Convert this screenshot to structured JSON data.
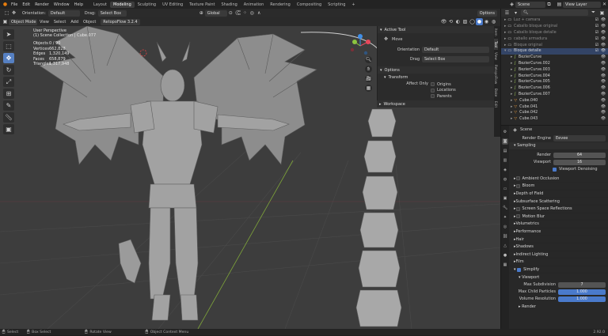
{
  "menubar": {
    "menus": [
      "File",
      "Edit",
      "Render",
      "Window",
      "Help"
    ],
    "workspaces": [
      "Layout",
      "Modeling",
      "Sculpting",
      "UV Editing",
      "Texture Paint",
      "Shading",
      "Animation",
      "Rendering",
      "Compositing",
      "Scripting"
    ],
    "active_workspace": "Modeling",
    "add_tab": "+",
    "scene": "Scene",
    "view_layer": "View Layer"
  },
  "tool_header": {
    "orientation_label": "Orientation:",
    "orientation_value": "Default",
    "drag_label": "Drag:",
    "drag_value": "Select Box",
    "transform_value": "Global",
    "options_label": "Options"
  },
  "viewport_header": {
    "mode": "Object Mode",
    "menus": [
      "View",
      "Select",
      "Add",
      "Object"
    ],
    "addon": "RetopoFlow 3.2.4"
  },
  "viewport": {
    "title": "User Perspective",
    "collection": "(1) Scene Collection | Cube.077",
    "stats": [
      {
        "label": "Objects",
        "value": "0 / 90"
      },
      {
        "label": "Vertices",
        "value": "662,828"
      },
      {
        "label": "Edges",
        "value": "1,320,149"
      },
      {
        "label": "Faces",
        "value": "658,879"
      },
      {
        "label": "Triangles",
        "value": "1,317,948"
      }
    ]
  },
  "n_panel": {
    "tabs": [
      "Item",
      "Tool",
      "View",
      "RetopoFlow",
      "Bake",
      "Edit"
    ],
    "active_tool_title": "Active Tool",
    "tool_name": "Move",
    "orientation_label": "Orientation",
    "orientation_value": "Default",
    "drag_label": "Drag",
    "drag_value": "Select Box",
    "options_title": "Options",
    "transform_title": "Transform",
    "affect_only_label": "Affect Only",
    "affect_items": [
      "Origins",
      "Locations",
      "Parents"
    ],
    "workspace_title": "Workspace"
  },
  "outliner": {
    "rows": [
      {
        "name": "Luz + camara",
        "indent": 0,
        "expanded": false,
        "icon": "collection",
        "color": "#8a8a8a"
      },
      {
        "name": "Caballo bloque original",
        "indent": 0,
        "expanded": false,
        "icon": "collection",
        "color": "#8a8a8a"
      },
      {
        "name": "Caballo bloque detalle",
        "indent": 0,
        "expanded": false,
        "icon": "collection",
        "color": "#8a8a8a"
      },
      {
        "name": "caballo armadura",
        "indent": 0,
        "expanded": false,
        "icon": "collection",
        "color": "#8a8a8a"
      },
      {
        "name": "Bloque original",
        "indent": 0,
        "expanded": false,
        "icon": "collection",
        "color": "#8a8a8a"
      },
      {
        "name": "Bloque detalle",
        "indent": 0,
        "expanded": true,
        "icon": "collection",
        "color": "#d0d0d0"
      },
      {
        "name": "BezierCurve",
        "indent": 1,
        "expanded": false,
        "icon": "curve",
        "color": "#d0d0d0"
      },
      {
        "name": "BezierCurve.002",
        "indent": 1,
        "expanded": false,
        "icon": "curve",
        "color": "#d0d0d0"
      },
      {
        "name": "BezierCurve.003",
        "indent": 1,
        "expanded": false,
        "icon": "curve",
        "color": "#d0d0d0"
      },
      {
        "name": "BezierCurve.004",
        "indent": 1,
        "expanded": false,
        "icon": "curve",
        "color": "#d0d0d0"
      },
      {
        "name": "BezierCurve.005",
        "indent": 1,
        "expanded": false,
        "icon": "curve",
        "color": "#d0d0d0"
      },
      {
        "name": "BezierCurve.006",
        "indent": 1,
        "expanded": false,
        "icon": "curve",
        "color": "#d0d0d0"
      },
      {
        "name": "BezierCurve.007",
        "indent": 1,
        "expanded": false,
        "icon": "curve",
        "color": "#d0d0d0"
      },
      {
        "name": "Cube.040",
        "indent": 1,
        "expanded": false,
        "icon": "mesh",
        "color": "#d0d0d0"
      },
      {
        "name": "Cube.041",
        "indent": 1,
        "expanded": false,
        "icon": "mesh",
        "color": "#d0d0d0"
      },
      {
        "name": "Cube.042",
        "indent": 1,
        "expanded": false,
        "icon": "mesh",
        "color": "#d0d0d0"
      },
      {
        "name": "Cube.043",
        "indent": 1,
        "expanded": false,
        "icon": "mesh",
        "color": "#d0d0d0"
      }
    ]
  },
  "properties": {
    "scene_name": "Scene",
    "render_engine_label": "Render Engine",
    "render_engine_value": "Eevee",
    "sampling_title": "Sampling",
    "render_label": "Render",
    "render_value": "64",
    "viewport_label": "Viewport",
    "viewport_value": "16",
    "viewport_denoising": "Viewport Denoising",
    "sections": [
      {
        "name": "Ambient Occlusion",
        "check": true
      },
      {
        "name": "Bloom",
        "check": true
      },
      {
        "name": "Depth of Field",
        "check": false
      },
      {
        "name": "Subsurface Scattering",
        "check": false
      },
      {
        "name": "Screen Space Reflections",
        "check": true
      },
      {
        "name": "Motion Blur",
        "check": true
      },
      {
        "name": "Volumetrics",
        "check": false
      },
      {
        "name": "Performance",
        "check": false
      },
      {
        "name": "Hair",
        "check": false
      },
      {
        "name": "Shadows",
        "check": false
      },
      {
        "name": "Indirect Lighting",
        "check": false
      },
      {
        "name": "Film",
        "check": false
      }
    ],
    "simplify_title": "Simplify",
    "simplify_viewport_title": "Viewport",
    "max_subdivision_label": "Max Subdivision",
    "max_subdivision_value": "7",
    "max_child_particles_label": "Max Child Particles",
    "max_child_particles_value": "1.000",
    "volume_resolution_label": "Volume Resolution",
    "volume_resolution_value": "1.000",
    "render_sub_title": "Render"
  },
  "statusbar": {
    "select": "Select",
    "box_select": "Box Select",
    "rotate_view": "Rotate View",
    "context_menu": "Object Context Menu",
    "version": "2.92.0"
  },
  "colors": {
    "accent": "#4a7acb",
    "axis_x": "#e8475b",
    "axis_y": "#8cc43f",
    "axis_z": "#3f8ee8",
    "viewport_bg": "#3d3d3d"
  }
}
